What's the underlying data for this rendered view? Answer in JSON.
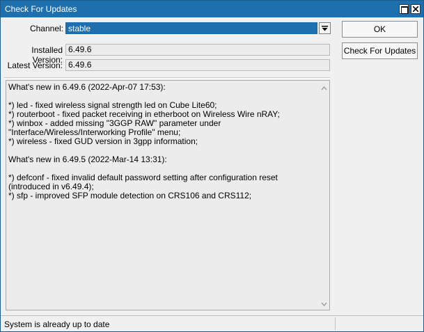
{
  "window": {
    "title": "Check For Updates"
  },
  "form": {
    "channel_label": "Channel:",
    "channel_value": "stable",
    "installed_label": "Installed Version:",
    "installed_value": "6.49.6",
    "latest_label": "Latest Version:",
    "latest_value": "6.49.6"
  },
  "buttons": {
    "ok_label": "OK",
    "check_label": "Check For Updates"
  },
  "changelog": {
    "text": "What's new in 6.49.6 (2022-Apr-07 17:53):\n\n*) led - fixed wireless signal strength led on Cube Lite60;\n*) routerboot - fixed packet receiving in etherboot on Wireless Wire nRAY;\n*) winbox - added missing \"3GGP RAW\" parameter under \"Interface/Wireless/Interworking Profile\" menu;\n*) wireless - fixed GUD version in 3gpp information;\n\nWhat's new in 6.49.5 (2022-Mar-14 13:31):\n\n*) defconf - fixed invalid default password setting after configuration reset (introduced in v6.49.4);\n*) sfp - improved SFP module detection on CRS106 and CRS112;"
  },
  "status": {
    "text": "System is already up to date"
  },
  "colors": {
    "titlebar": "#1e6fae",
    "selection": "#1e6fae",
    "field_bg": "#ececec"
  },
  "icons": {
    "maximize": "maximize-icon",
    "close": "close-icon",
    "dropdown": "chevron-down-icon",
    "scroll_up": "scroll-up-icon",
    "scroll_down": "scroll-down-icon"
  }
}
